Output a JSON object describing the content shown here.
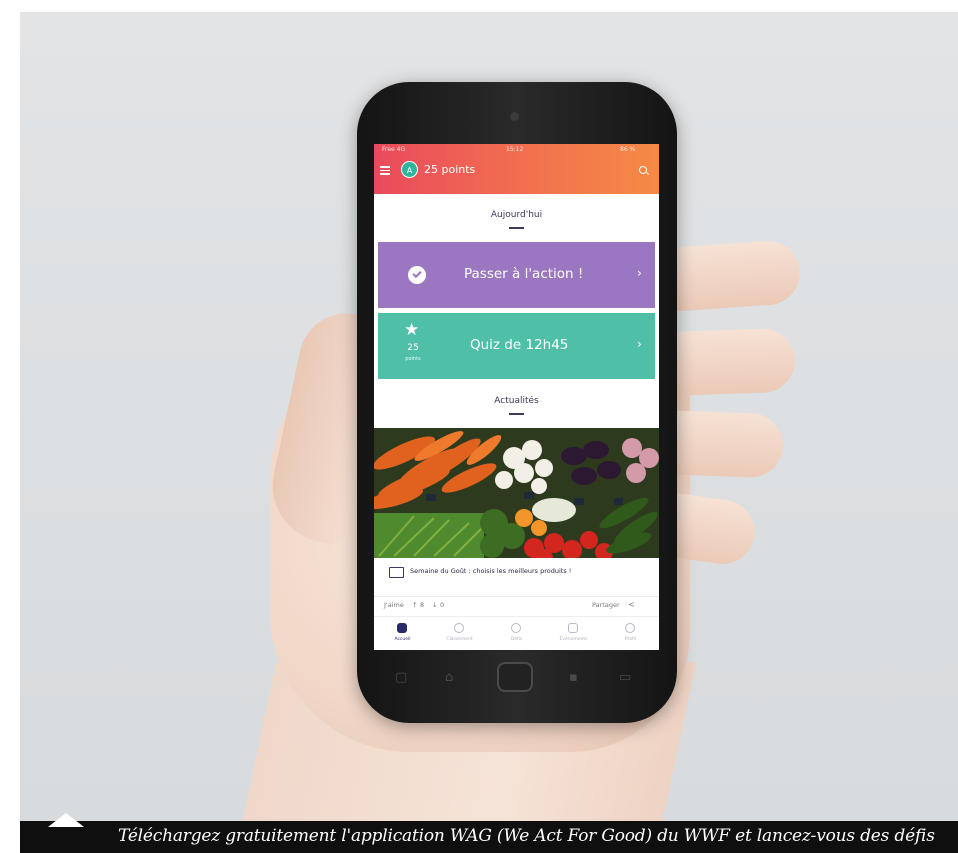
{
  "status_bar": {
    "carrier": "Free 4G",
    "time": "15:12",
    "battery": "86 %"
  },
  "header": {
    "avatar_initial": "A",
    "points": "25 points"
  },
  "today": {
    "title": "Aujourd'hui",
    "action_card": {
      "label": "Passer à l'action !",
      "arrow": "›"
    },
    "quiz_card": {
      "label": "Quiz de 12h45",
      "points_value": "25",
      "points_unit": "points",
      "arrow": "›"
    }
  },
  "news": {
    "title": "Actualités",
    "item_title": "Semaine du Goût : choisis les meilleurs produits !",
    "like_label": "J'aime",
    "likes": "8",
    "dislikes": "0",
    "share_label": "Partager"
  },
  "tabs": [
    {
      "label": "Accueil",
      "active": true
    },
    {
      "label": "Classement",
      "active": false
    },
    {
      "label": "Défis",
      "active": false
    },
    {
      "label": "Événements",
      "active": false
    },
    {
      "label": "Profil",
      "active": false
    }
  ],
  "caption": "Téléchargez gratuitement l'application WAG (We Act For Good) du WWF et lancez-vous des défis",
  "colors": {
    "header_start": "#e94a5c",
    "header_end": "#f58a45",
    "action_card": "#9b77c1",
    "quiz_card": "#4fbfa8",
    "caption_bg": "#0f0f0f"
  }
}
